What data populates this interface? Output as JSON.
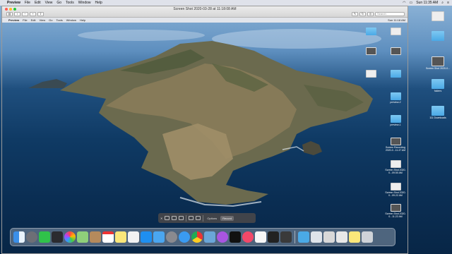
{
  "outer_menubar": {
    "app_name": "Preview",
    "items": [
      "File",
      "Edit",
      "View",
      "Go",
      "Tools",
      "Window",
      "Help"
    ],
    "clock": "Sun 11:35 AM"
  },
  "window": {
    "title": "Screen Shot 2020-03-28 at 11:18:08 AM",
    "search_placeholder": "Search"
  },
  "inner_menubar": {
    "app_name": "Preview",
    "items": [
      "File",
      "Edit",
      "View",
      "Go",
      "Tools",
      "Window",
      "Help"
    ],
    "clock": "Sun 11:18 AM"
  },
  "inner_desktop_files": [
    "",
    "",
    "",
    "",
    "",
    "",
    "preview-2",
    "preview-1",
    "Screen Recording 2020-0...11.47 AM",
    "Screen Shot 2020-0...09.50 AM",
    "Screen Shot 2020-0...09.22 AM",
    "Screen Shot 2020-0...11.22 AM"
  ],
  "outer_desktop_files": [
    "Screen Shot 2020-0...",
    "folders",
    "111 Downloads"
  ],
  "screenshot_toolbar": {
    "options_label": "Options",
    "capture_label": "Record"
  },
  "colors": {
    "menubar": "#e6e6eb",
    "folder": "#4aa9e6",
    "traffic_red": "#fd5f57",
    "traffic_yellow": "#fdbc2e",
    "traffic_green": "#28c840"
  },
  "dock_icons": [
    "finder-icon",
    "launchpad-icon",
    "messages-icon",
    "facetime-icon",
    "photos-icon",
    "maps-icon",
    "contacts-icon",
    "calendar-icon",
    "notes-icon",
    "reminders-icon",
    "appstore-icon",
    "mail-icon",
    "system-prefs-icon",
    "safari-icon",
    "chrome-icon",
    "preview-icon",
    "podcasts-icon",
    "appletv-icon",
    "music-icon",
    "news-icon",
    "stocks-icon",
    "activity-monitor-icon",
    "downloads-folder-icon",
    "documents-folder-icon",
    "screenshot-stack-icon",
    "trash-icon"
  ]
}
